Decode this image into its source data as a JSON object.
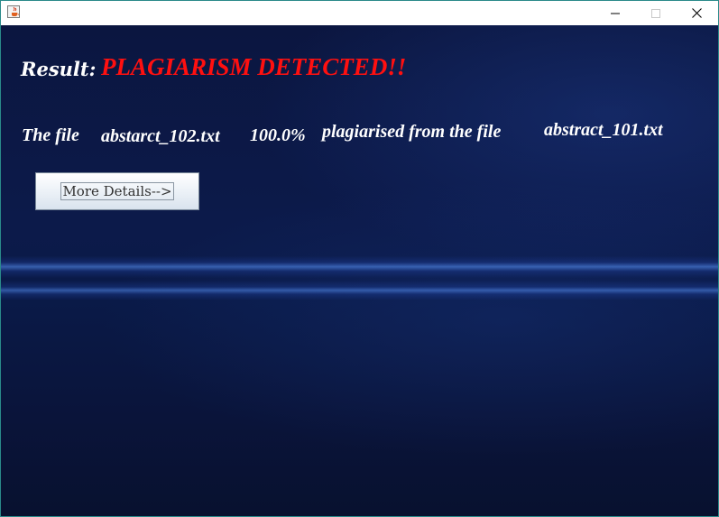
{
  "window": {
    "title": "",
    "icon": "java-cup-icon",
    "controls": [
      "minimize-icon",
      "maximize-icon",
      "close-icon"
    ]
  },
  "result": {
    "label": "Result:",
    "value": "PLAGIARISM DETECTED!!",
    "value_color": "#ff1010"
  },
  "detail": {
    "prefix": "The file",
    "source_file": "abstarct_102.txt",
    "percentage": "100.0%",
    "middle": "plagiarised from the file",
    "target_file": "abstract_101.txt"
  },
  "more_button": {
    "label": "More Details-->"
  }
}
